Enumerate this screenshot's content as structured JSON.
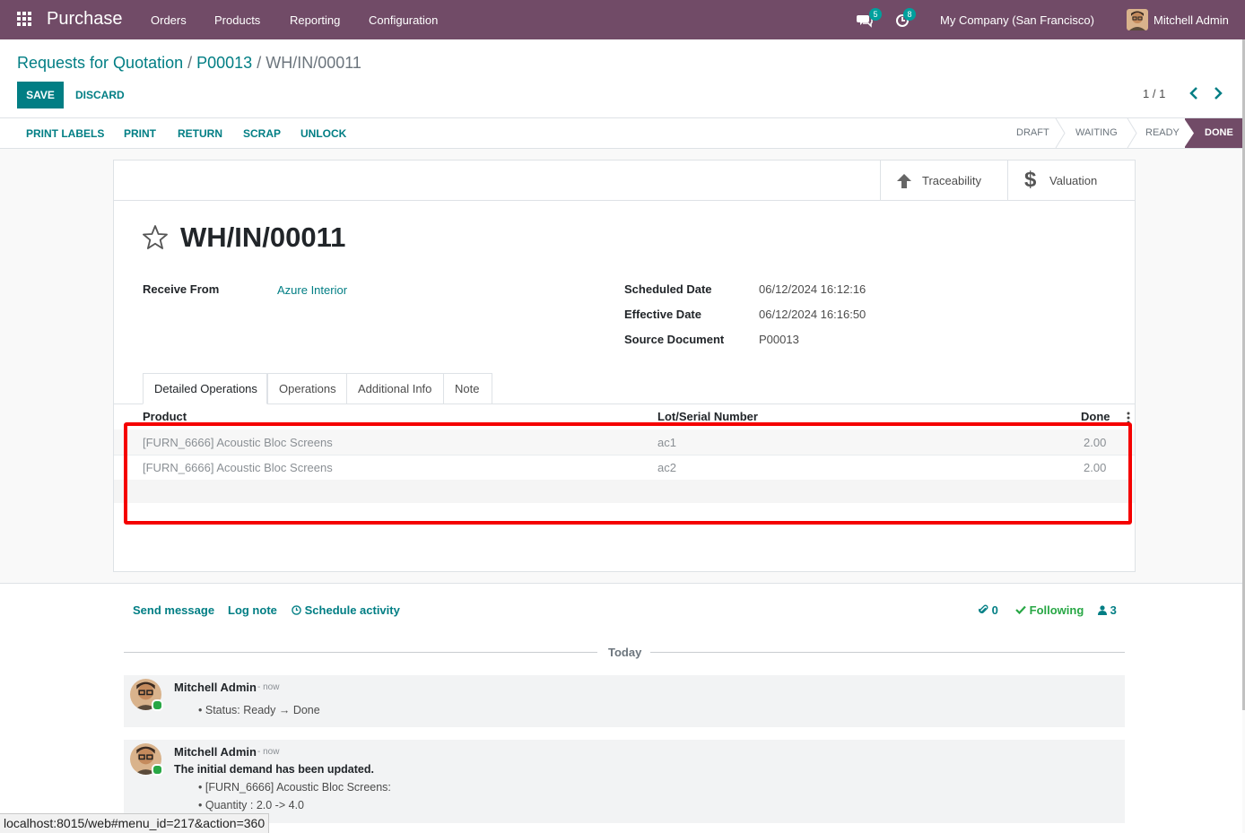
{
  "app": {
    "name": "Purchase"
  },
  "nav": {
    "menus": [
      "Orders",
      "Products",
      "Reporting",
      "Configuration"
    ],
    "messages_badge": "5",
    "activities_badge": "8",
    "company": "My Company (San Francisco)",
    "user": "Mitchell Admin"
  },
  "breadcrumb": {
    "root": "Requests for Quotation",
    "sep1": " / ",
    "order": "P00013",
    "sep2": " / ",
    "current": "WH/IN/00011"
  },
  "actions": {
    "save": "SAVE",
    "discard": "DISCARD"
  },
  "pager": {
    "value": "1 / 1"
  },
  "statusbar": {
    "buttons": [
      "PRINT LABELS",
      "PRINT",
      "RETURN",
      "SCRAP",
      "UNLOCK"
    ],
    "stages": [
      "DRAFT",
      "WAITING",
      "READY",
      "DONE"
    ],
    "current_stage": "DONE"
  },
  "smart_buttons": {
    "traceability": "Traceability",
    "valuation": "Valuation"
  },
  "record": {
    "name": "WH/IN/00011",
    "receive_from_label": "Receive From",
    "receive_from": "Azure Interior",
    "scheduled_date_label": "Scheduled Date",
    "scheduled_date": "06/12/2024 16:12:16",
    "effective_date_label": "Effective Date",
    "effective_date": "06/12/2024 16:16:50",
    "source_document_label": "Source Document",
    "source_document": "P00013"
  },
  "tabs": [
    "Detailed Operations",
    "Operations",
    "Additional Info",
    "Note"
  ],
  "table": {
    "headers": {
      "product": "Product",
      "lot": "Lot/Serial Number",
      "done": "Done"
    },
    "rows": [
      {
        "product": "[FURN_6666] Acoustic Bloc Screens",
        "lot": "ac1",
        "done": "2.00"
      },
      {
        "product": "[FURN_6666] Acoustic Bloc Screens",
        "lot": "ac2",
        "done": "2.00"
      }
    ]
  },
  "chatter": {
    "send_message": "Send message",
    "log_note": "Log note",
    "schedule_activity": "Schedule activity",
    "attachments_count": "0",
    "following": "Following",
    "followers_count": "3",
    "date_separator": "Today",
    "messages": [
      {
        "author": "Mitchell Admin",
        "time": "- now",
        "lines": [
          "Status: Ready → Done"
        ]
      },
      {
        "author": "Mitchell Admin",
        "time": "- now",
        "heading": "The initial demand has been updated.",
        "lines": [
          "[FURN_6666] Acoustic Bloc Screens:",
          "Quantity : 2.0 -> 4.0"
        ]
      }
    ]
  },
  "status_url": "localhost:8015/web#menu_id=217&action=360",
  "colors": {
    "brand": "#714b67",
    "accent": "#017e84",
    "highlight": "#f50000"
  }
}
